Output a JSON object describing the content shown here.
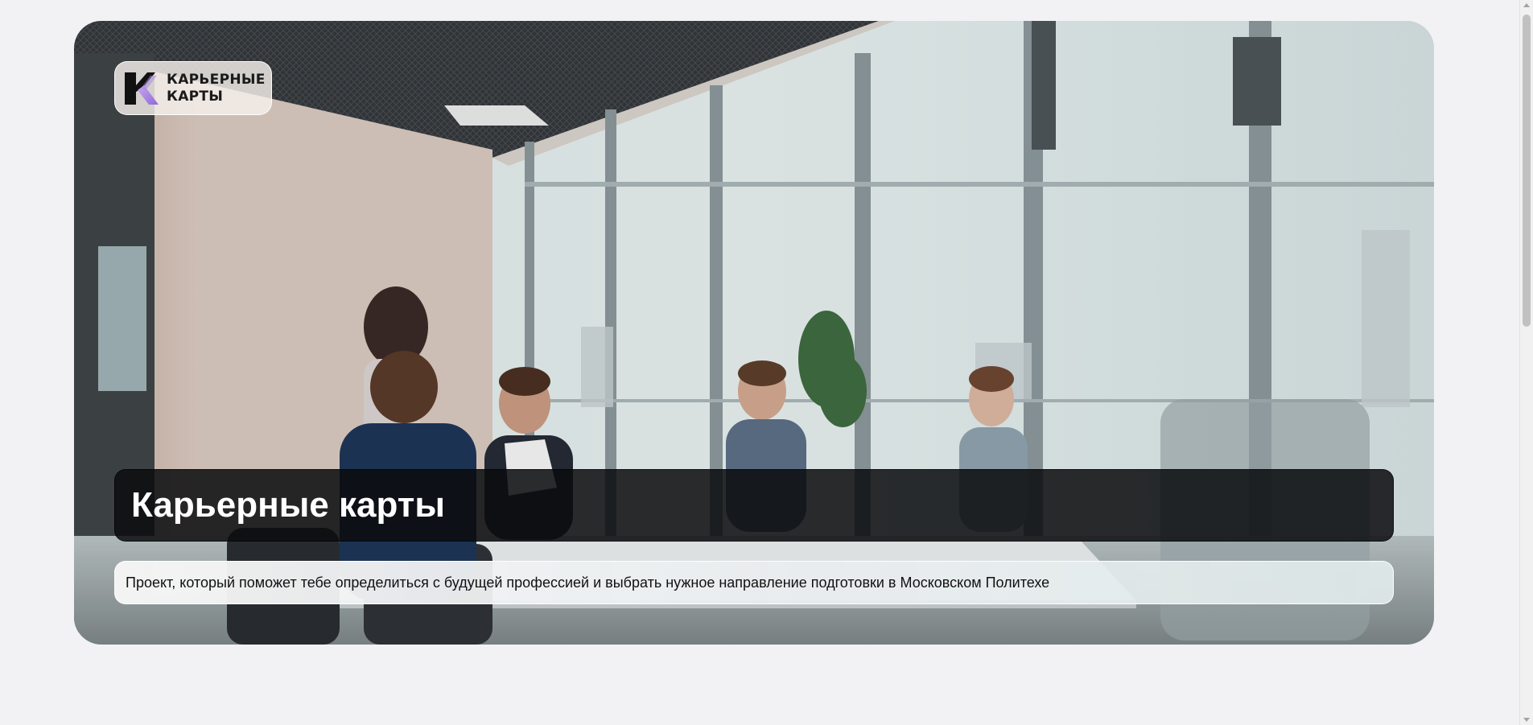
{
  "logo": {
    "line1": "КАРЬЕРНЫЕ",
    "line2": "КАРТЫ"
  },
  "hero": {
    "title": "Карьерные карты",
    "subtitle": "Проект, который поможет тебе определиться с будущей профессией и выбрать нужное направление подготовки в Московском Политехе"
  },
  "colors": {
    "page_background": "#f2f2f4",
    "title_bar": "#0a0c0e",
    "logo_accent": "#b48ee0"
  },
  "icons": {
    "logo_mark": "k-logo-icon"
  }
}
